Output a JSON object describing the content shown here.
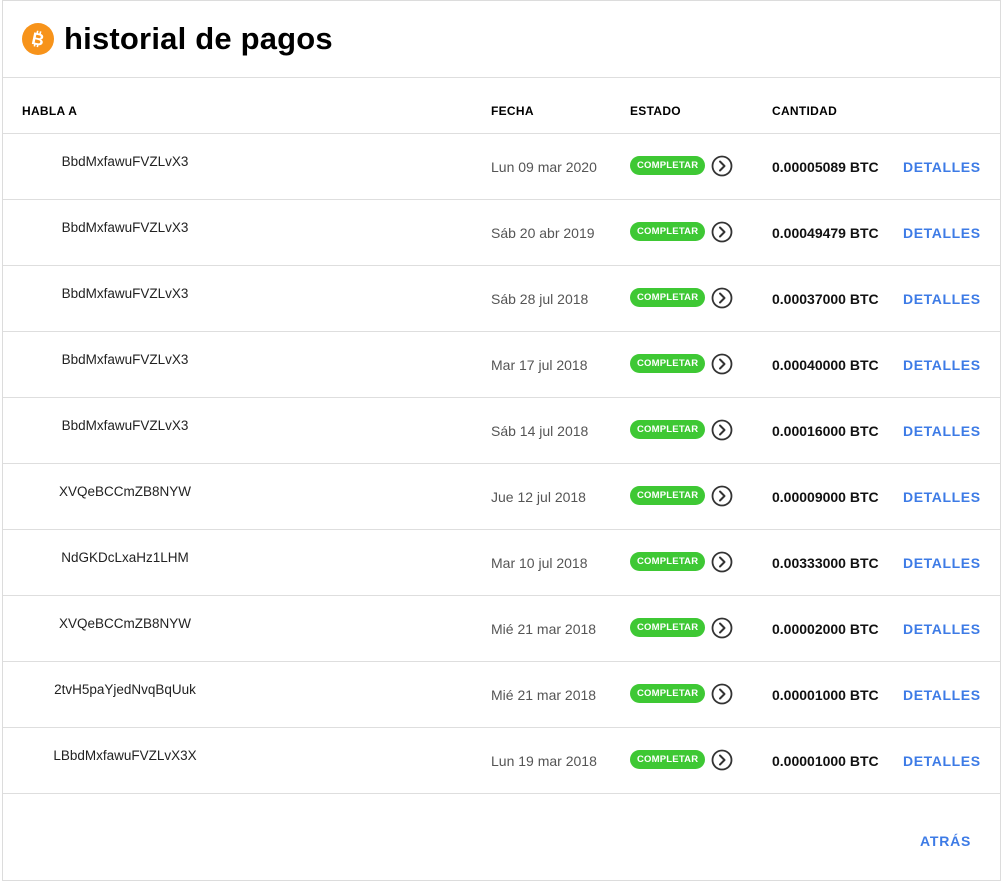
{
  "page": {
    "title": "historial de pagos",
    "icon": "bitcoin-icon",
    "accent_color": "#f7931a",
    "link_color": "#3d7be6",
    "badge_color": "#3ec834"
  },
  "table": {
    "headers": {
      "name": "HABLA A",
      "date": "FECHA",
      "status": "ESTADO",
      "amount": "CANTIDAD"
    },
    "rows": [
      {
        "name": "BbdMxfawuFVZLvX3",
        "date": "Lun 09 mar 2020",
        "status": "COMPLETAR",
        "amount": "0.00005089 BTC",
        "link": "DETALLES"
      },
      {
        "name": "BbdMxfawuFVZLvX3",
        "date": "Sáb 20 abr 2019",
        "status": "COMPLETAR",
        "amount": "0.00049479 BTC",
        "link": "DETALLES"
      },
      {
        "name": "BbdMxfawuFVZLvX3",
        "date": "Sáb 28 jul 2018",
        "status": "COMPLETAR",
        "amount": "0.00037000 BTC",
        "link": "DETALLES"
      },
      {
        "name": "BbdMxfawuFVZLvX3",
        "date": "Mar 17 jul 2018",
        "status": "COMPLETAR",
        "amount": "0.00040000 BTC",
        "link": "DETALLES"
      },
      {
        "name": "BbdMxfawuFVZLvX3",
        "date": "Sáb 14 jul 2018",
        "status": "COMPLETAR",
        "amount": "0.00016000 BTC",
        "link": "DETALLES"
      },
      {
        "name": "XVQeBCCmZB8NYW",
        "date": "Jue 12 jul 2018",
        "status": "COMPLETAR",
        "amount": "0.00009000 BTC",
        "link": "DETALLES"
      },
      {
        "name": "NdGKDcLxaHz1LHM",
        "date": "Mar 10 jul 2018",
        "status": "COMPLETAR",
        "amount": "0.00333000 BTC",
        "link": "DETALLES"
      },
      {
        "name": "XVQeBCCmZB8NYW",
        "date": "Mié 21 mar 2018",
        "status": "COMPLETAR",
        "amount": "0.00002000 BTC",
        "link": "DETALLES"
      },
      {
        "name": "2tvH5paYjedNvqBqUuk",
        "date": "Mié 21 mar 2018",
        "status": "COMPLETAR",
        "amount": "0.00001000 BTC",
        "link": "DETALLES"
      },
      {
        "name": "LBbdMxfawuFVZLvX3X",
        "date": "Lun 19 mar 2018",
        "status": "COMPLETAR",
        "amount": "0.00001000 BTC",
        "link": "DETALLES"
      }
    ]
  },
  "footer": {
    "back_label": "ATRÁS"
  }
}
